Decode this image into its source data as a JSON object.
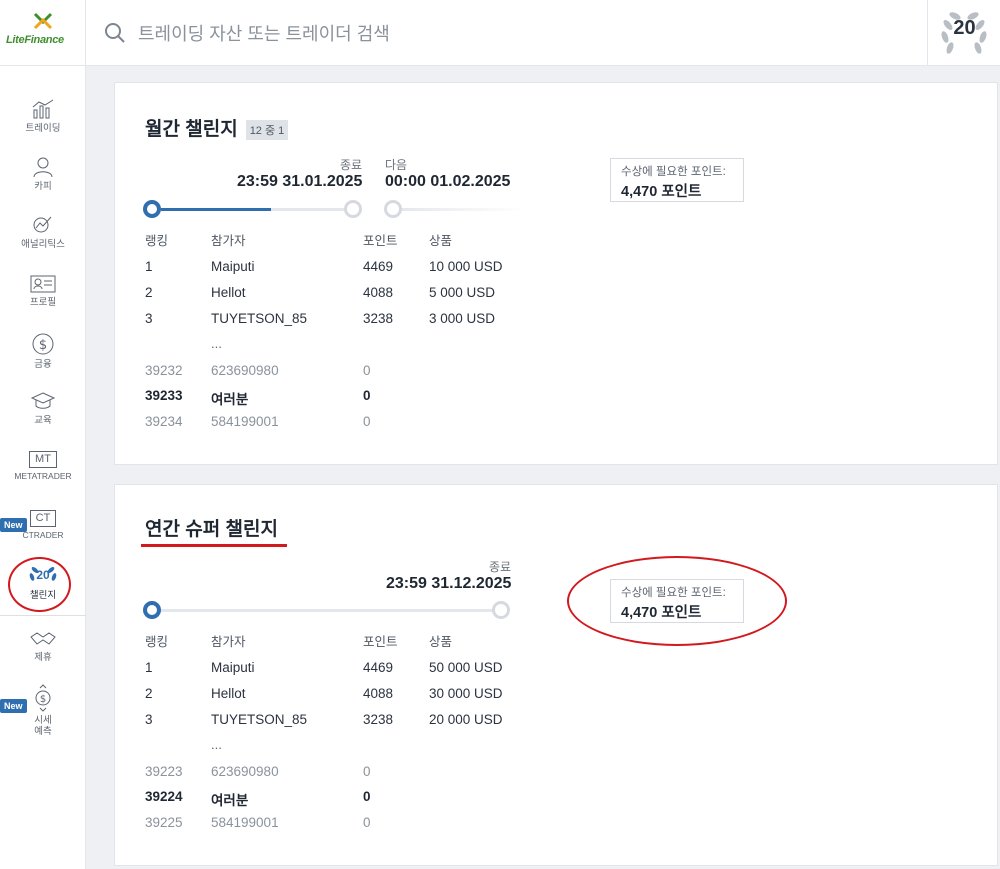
{
  "header": {
    "logo_text": "LiteFinance",
    "search_placeholder": "트레이딩 자산 또는 트레이더 검색",
    "anniversary_badge": "20"
  },
  "sidebar": {
    "items": [
      {
        "label": "트레이딩",
        "icon": "chart-icon"
      },
      {
        "label": "카피",
        "icon": "user-icon"
      },
      {
        "label": "애널리틱스",
        "icon": "analytics-icon"
      },
      {
        "label": "프로필",
        "icon": "profile-card-icon"
      },
      {
        "label": "금융",
        "icon": "dollar-icon"
      },
      {
        "label": "교육",
        "icon": "graduation-cap-icon"
      },
      {
        "label": "METATRADER",
        "icon": "mt-icon",
        "icon_text": "MT"
      },
      {
        "label": "CTRADER",
        "icon": "ct-icon",
        "icon_text": "CT",
        "badge": "New"
      },
      {
        "label": "챌린지",
        "icon": "laurel-20-icon",
        "icon_text": "20"
      },
      {
        "label": "제휴",
        "icon": "handshake-icon"
      },
      {
        "label": "시세\n예측",
        "icon": "dollar-arrows-icon",
        "badge": "New"
      }
    ]
  },
  "monthly": {
    "title": "월간 챌린지",
    "pager": "12 중 1",
    "end_label": "종료",
    "end_time": "23:59 31.01.2025",
    "next_label": "다음",
    "next_time": "00:00 01.02.2025",
    "progress": 0.6,
    "points_label": "수상에 필요한 포인트:",
    "points_value": "4,470 포인트",
    "columns": [
      "랭킹",
      "참가자",
      "포인트",
      "상품"
    ],
    "rows": [
      {
        "rank": "1",
        "name": "Maiputi",
        "points": "4469",
        "prize": "10 000 USD"
      },
      {
        "rank": "2",
        "name": "Hellot",
        "points": "4088",
        "prize": "5 000 USD"
      },
      {
        "rank": "3",
        "name": "TUYETSON_85",
        "points": "3238",
        "prize": "3 000 USD"
      }
    ],
    "ellipsis": "...",
    "near_rows": [
      {
        "rank": "39232",
        "name": "623690980",
        "points": "0"
      },
      {
        "rank": "39233",
        "name": "여러분",
        "points": "0"
      },
      {
        "rank": "39234",
        "name": "584199001",
        "points": "0"
      }
    ]
  },
  "annual": {
    "title": "연간 슈퍼 챌린지",
    "end_label": "종료",
    "end_time": "23:59 31.12.2025",
    "progress": 0.0,
    "points_label": "수상에 필요한 포인트:",
    "points_value": "4,470 포인트",
    "columns": [
      "랭킹",
      "참가자",
      "포인트",
      "상품"
    ],
    "rows": [
      {
        "rank": "1",
        "name": "Maiputi",
        "points": "4469",
        "prize": "50 000 USD"
      },
      {
        "rank": "2",
        "name": "Hellot",
        "points": "4088",
        "prize": "30 000 USD"
      },
      {
        "rank": "3",
        "name": "TUYETSON_85",
        "points": "3238",
        "prize": "20 000 USD"
      }
    ],
    "ellipsis": "...",
    "near_rows": [
      {
        "rank": "39223",
        "name": "623690980",
        "points": "0"
      },
      {
        "rank": "39224",
        "name": "여러분",
        "points": "0"
      },
      {
        "rank": "39225",
        "name": "584199001",
        "points": "0"
      }
    ]
  },
  "colors": {
    "accent_blue": "#2f6fb0",
    "annotation_red": "#d1191e",
    "brand_green": "#3f8f2f"
  }
}
